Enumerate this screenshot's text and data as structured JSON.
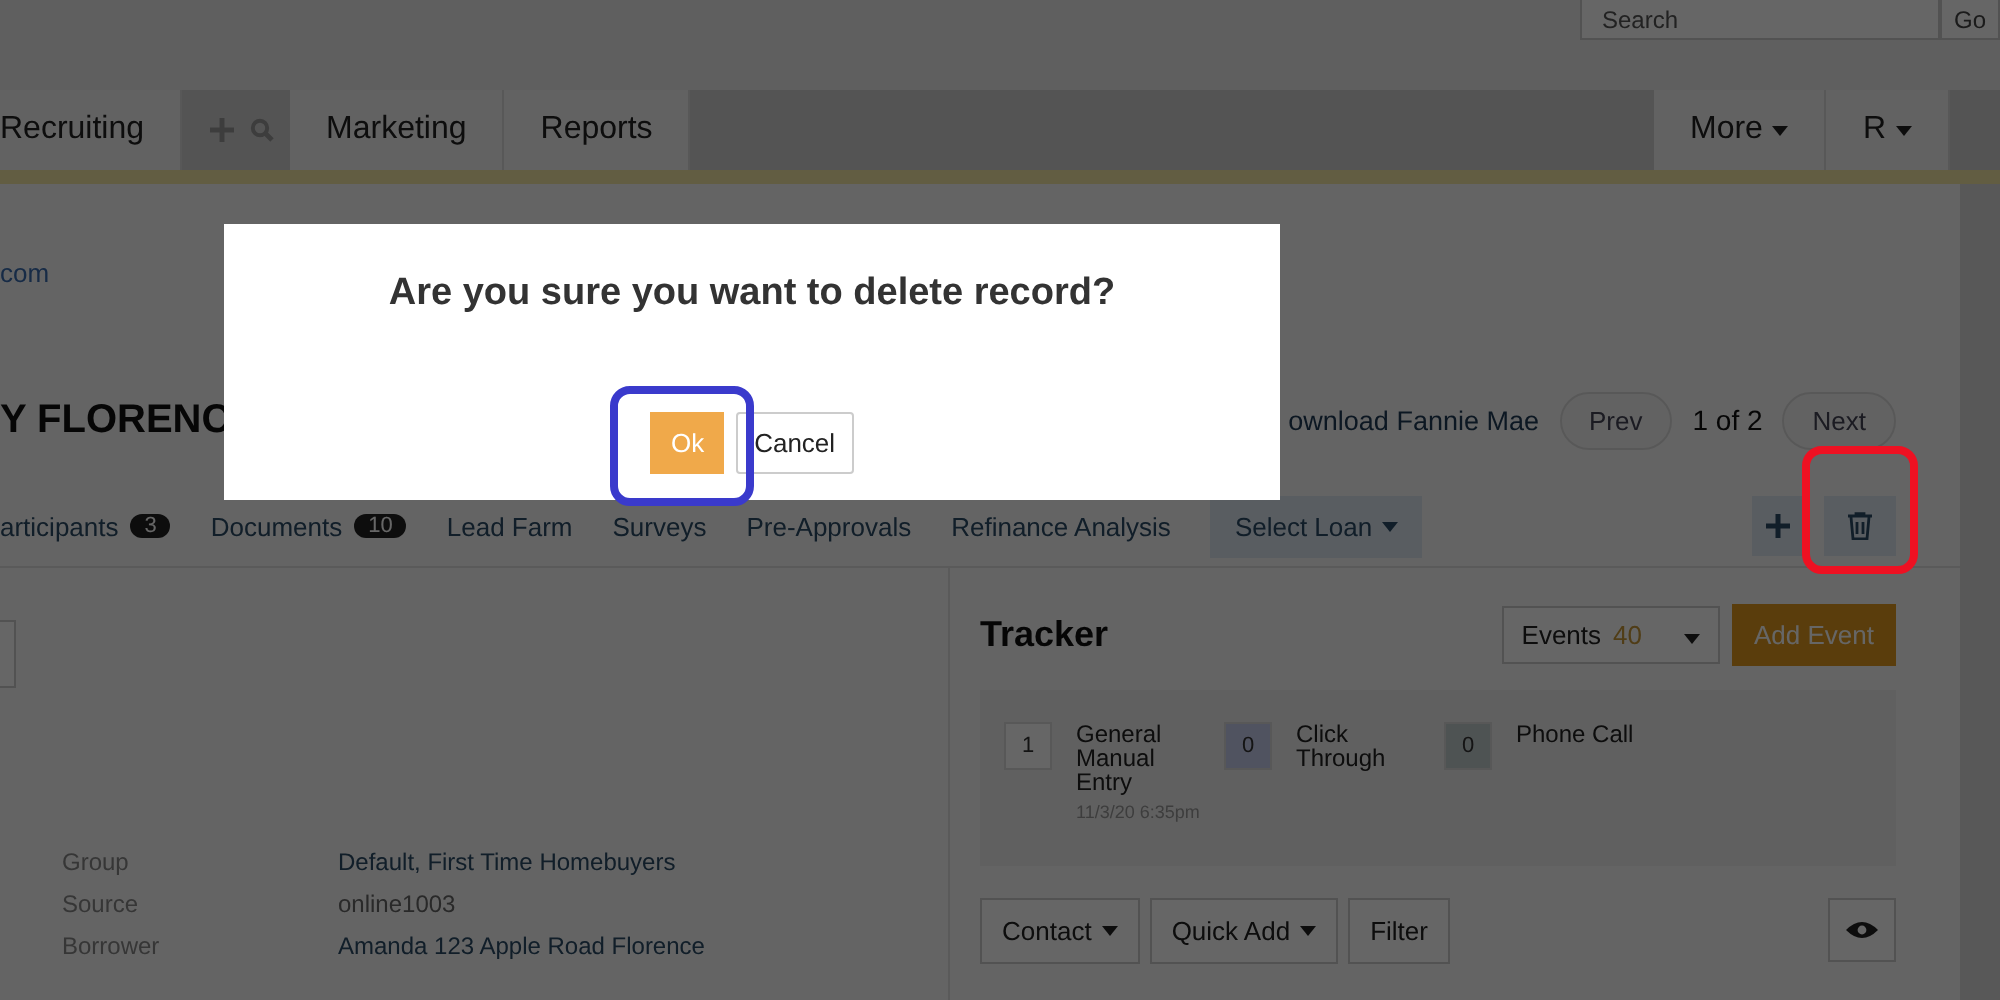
{
  "top_bar": {
    "search": {
      "placeholder": "Search"
    },
    "go_button": "Go"
  },
  "nav": {
    "tabs": [
      "Recruiting",
      "Marketing",
      "Reports"
    ],
    "right_menus": [
      "More",
      "R"
    ]
  },
  "record": {
    "link": "com",
    "title": "Y FLORENC",
    "download_link": "ownload Fannie Mae",
    "prev": "Prev",
    "pager": "1 of 2",
    "next": "Next",
    "tabs": [
      {
        "label": "articipants",
        "count": "3"
      },
      {
        "label": "Documents",
        "count": "10"
      },
      {
        "label": "Lead Farm"
      },
      {
        "label": "Surveys"
      },
      {
        "label": "Pre-Approvals"
      },
      {
        "label": "Refinance Analysis"
      }
    ],
    "select_loan": "Select Loan"
  },
  "details": [
    {
      "label": "Group",
      "value": "Default, First Time Homebuyers",
      "kind": "link"
    },
    {
      "label": "Source",
      "value": "online1003",
      "kind": "muted"
    },
    {
      "label": "Borrower",
      "value": "Amanda 123 Apple Road Florence",
      "kind": "link"
    }
  ],
  "tracker": {
    "title": "Tracker",
    "events_label": "Events",
    "events_count": "40",
    "add_event": "Add Event",
    "items": [
      {
        "count": "1",
        "label": "General Manual Entry",
        "time": "11/3/20 6:35pm",
        "kind": "general"
      },
      {
        "count": "0",
        "label": "Click Through",
        "kind": "click"
      },
      {
        "count": "0",
        "label": "Phone Call",
        "kind": "call"
      }
    ],
    "buttons": [
      {
        "label": "Contact",
        "kind": "dropdown"
      },
      {
        "label": "Quick Add",
        "kind": "dropdown"
      },
      {
        "label": "Filter",
        "kind": "plain"
      }
    ]
  },
  "dialog": {
    "message": "Are you sure you want to delete record?",
    "ok": "Ok",
    "cancel": "Cancel"
  }
}
